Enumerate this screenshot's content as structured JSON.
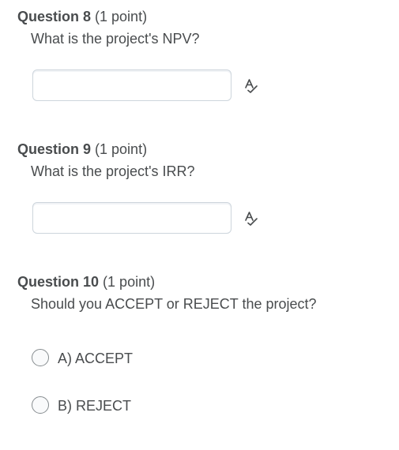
{
  "questions": [
    {
      "title": "Question 8",
      "points": "(1 point)",
      "prompt": "What is the project's NPV?",
      "answer_value": "",
      "answer_placeholder": "",
      "icon": "spellcheck-icon"
    },
    {
      "title": "Question 9",
      "points": "(1 point)",
      "prompt": "What is the project's IRR?",
      "answer_value": "",
      "answer_placeholder": "",
      "icon": "spellcheck-icon"
    },
    {
      "title": "Question 10",
      "points": "(1 point)",
      "prompt": "Should you ACCEPT or REJECT the project?",
      "options": [
        {
          "label": "A) ACCEPT",
          "selected": false
        },
        {
          "label": "B) REJECT",
          "selected": false
        }
      ]
    }
  ],
  "colors": {
    "text": "#494c4e",
    "input_border": "#cdd5dc",
    "radio_border": "#868c8f",
    "icon": "#494c4e"
  }
}
